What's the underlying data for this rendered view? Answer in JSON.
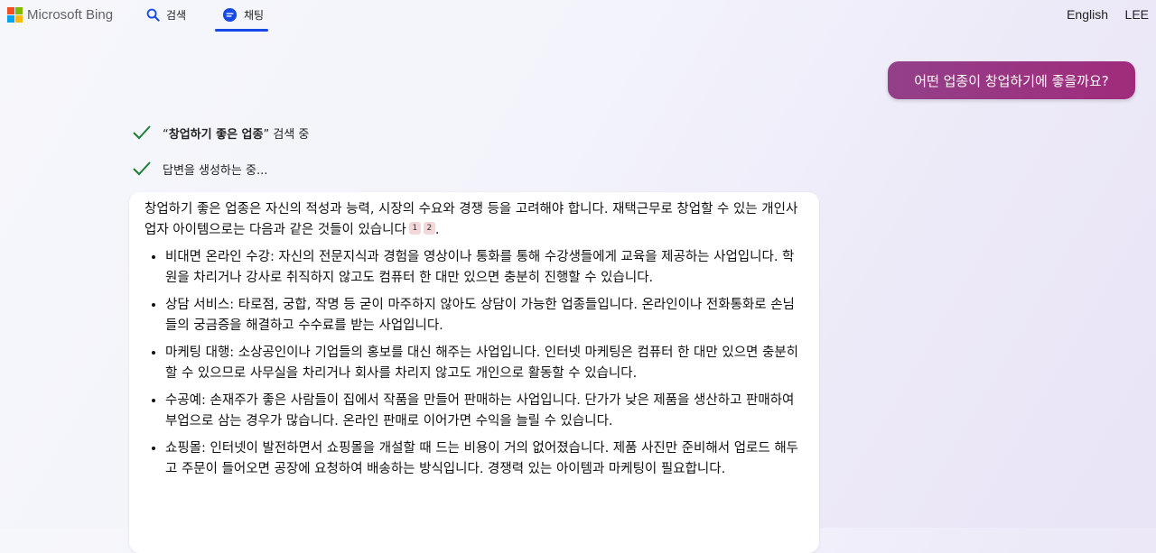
{
  "header": {
    "brand": "Microsoft Bing",
    "nav": {
      "search_label": "검색",
      "chat_label": "채팅"
    },
    "language": "English",
    "user": "LEE",
    "logo_colors": [
      "#f25022",
      "#7fba00",
      "#00a4ef",
      "#ffb900"
    ],
    "accent": "#174ae4"
  },
  "chat": {
    "user_message": "어떤 업종이 창업하기에 좋을까요?",
    "status": [
      {
        "quote": "창업하기 좋은 업종",
        "text": " 검색 중"
      },
      {
        "text": "답변을 생성하는 중..."
      }
    ],
    "answer": {
      "intro": "창업하기 좋은 업종은 자신의 적성과 능력, 시장의 수요와 경쟁 등을 고려해야 합니다. 재택근무로 창업할 수 있는 개인사업자 아이템으로는 다음과 같은 것들이 있습니다",
      "citations": [
        "1",
        "2"
      ],
      "intro_end": ".",
      "items": [
        "비대면 온라인 수강: 자신의 전문지식과 경험을 영상이나 통화를 통해 수강생들에게 교육을 제공하는 사업입니다. 학원을 차리거나 강사로 취직하지 않고도 컴퓨터 한 대만 있으면 충분히 진행할 수 있습니다.",
        "상담 서비스: 타로점, 궁합, 작명 등 굳이 마주하지 않아도 상담이 가능한 업종들입니다. 온라인이나 전화통화로 손님들의 궁금증을 해결하고 수수료를 받는 사업입니다.",
        "마케팅 대행: 소상공인이나 기업들의 홍보를 대신 해주는 사업입니다. 인터넷 마케팅은 컴퓨터 한 대만 있으면 충분히 할 수 있으므로 사무실을 차리거나 회사를 차리지 않고도 개인으로 활동할 수 있습니다.",
        "수공예: 손재주가 좋은 사람들이 집에서 작품을 만들어 판매하는 사업입니다. 단가가 낮은 제품을 생산하고 판매하여 부업으로 삼는 경우가 많습니다. 온라인 판매로 이어가면 수익을 늘릴 수 있습니다.",
        "쇼핑몰: 인터넷이 발전하면서 쇼핑몰을 개설할 때 드는 비용이 거의 없어졌습니다. 제품 사진만 준비해서 업로드 해두고 주문이 들어오면 공장에 요청하여 배송하는 방식입니다. 경쟁력 있는 아이템과 마케팅이 필요합니다."
      ]
    }
  },
  "colors": {
    "user_bubble": "#9a3782",
    "check": "#1a7f37",
    "citation_bg": "#f3d7d9"
  }
}
